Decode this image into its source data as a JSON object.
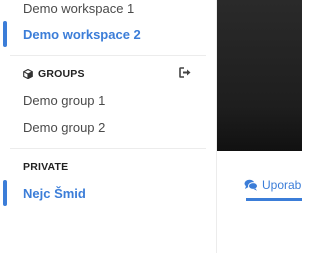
{
  "sidebar": {
    "workspaces": [
      {
        "label": "Demo workspace 1",
        "active": false
      },
      {
        "label": "Demo workspace 2",
        "active": true
      }
    ],
    "groups": {
      "header": "GROUPS",
      "header_icon": "cube-icon",
      "action_icon": "export-icon",
      "items": [
        {
          "label": "Demo group 1"
        },
        {
          "label": "Demo group 2"
        }
      ]
    },
    "private": {
      "header": "PRIVATE",
      "items": [
        {
          "label": "Nejc Šmid",
          "active": true
        }
      ]
    }
  },
  "main": {
    "tab_label": "Uporab",
    "tab_icon": "comments-icon"
  },
  "colors": {
    "accent": "#3b7dd8",
    "text": "#4a4a4a",
    "header": "#222222",
    "video_bg": "#1e1e1e"
  }
}
